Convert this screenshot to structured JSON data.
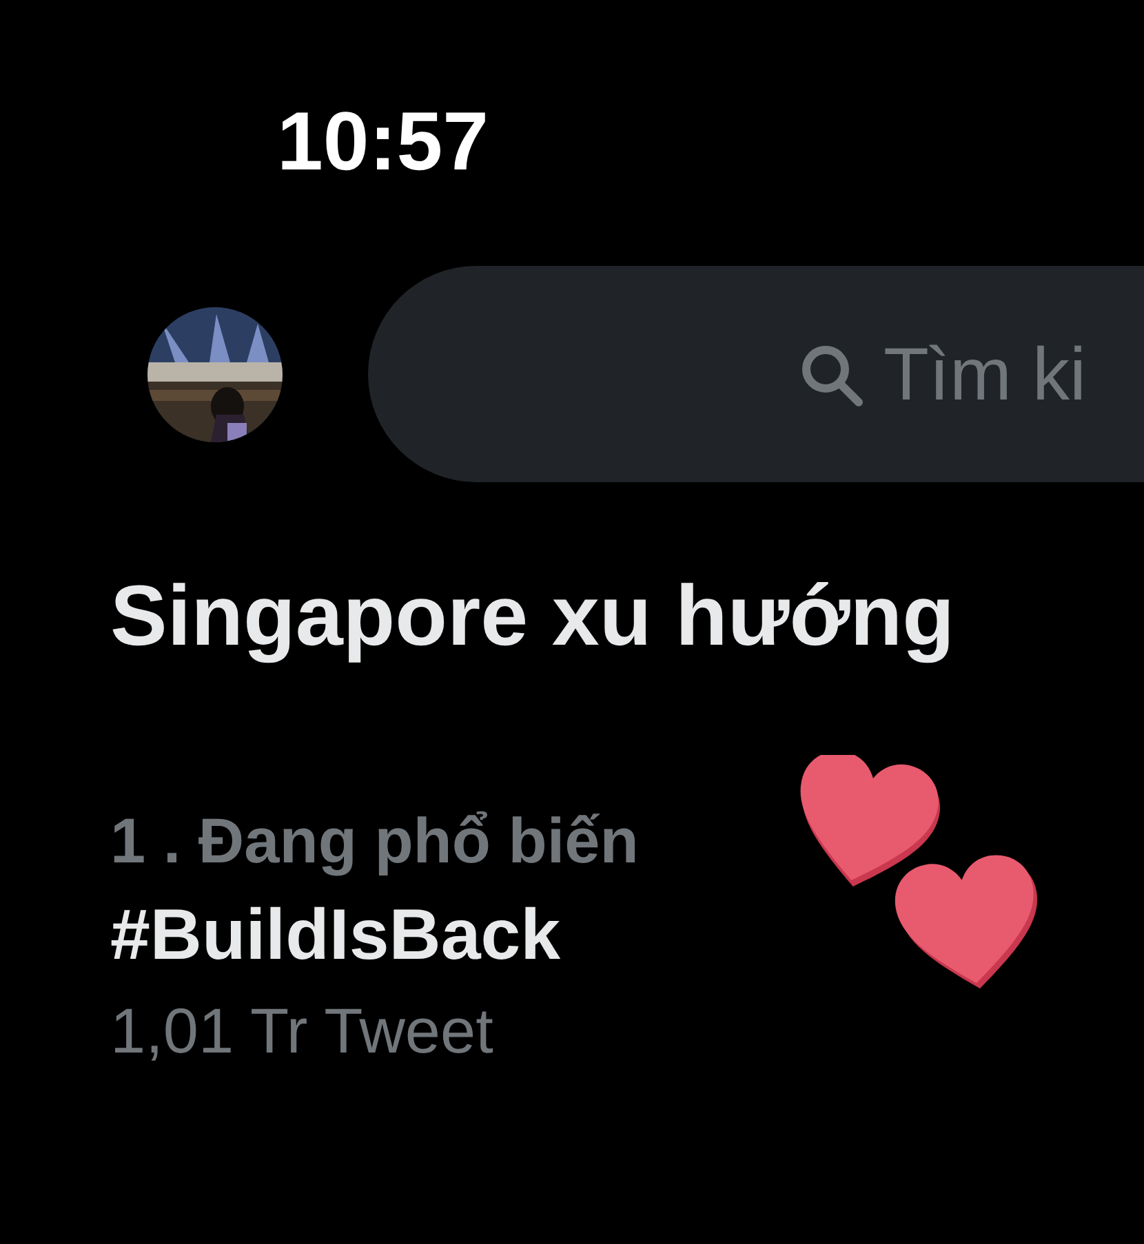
{
  "status_bar": {
    "time": "10:57"
  },
  "search": {
    "placeholder": "Tìm ki"
  },
  "section_title": "Singapore xu hướng",
  "trends": [
    {
      "context": "1 . Đang phổ biến",
      "name": "#BuildIsBack",
      "count": "1,01 Tr Tweet"
    }
  ]
}
